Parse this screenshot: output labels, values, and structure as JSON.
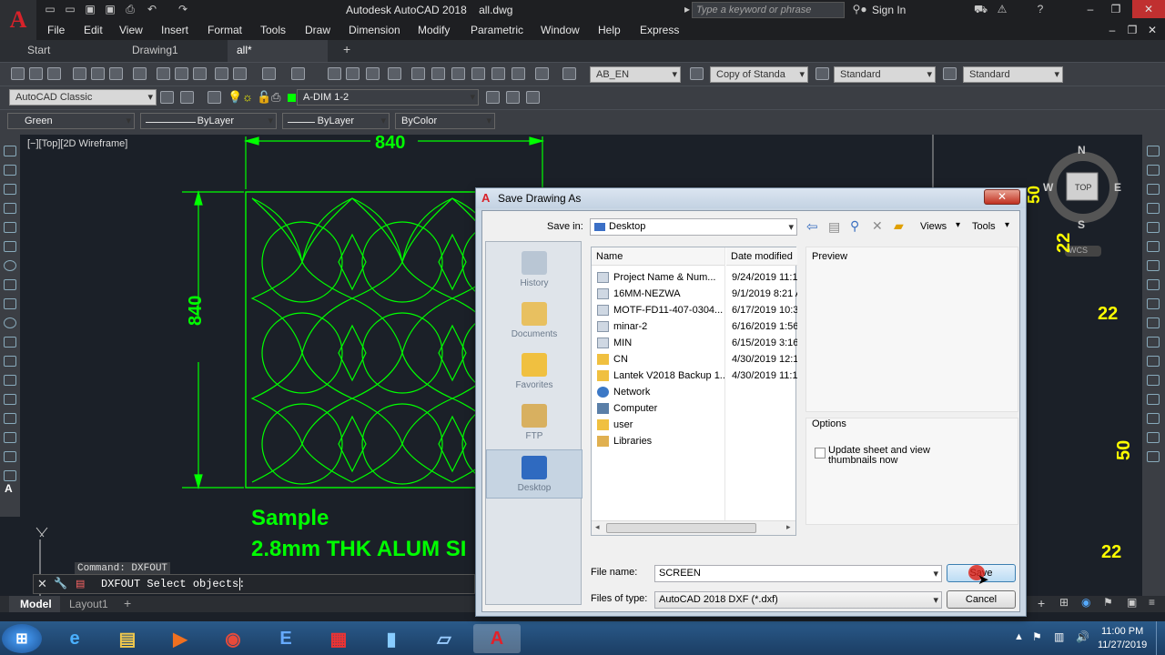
{
  "app": {
    "title": "Autodesk AutoCAD 2018    all.dwg",
    "search_placeholder": "Type a keyword or phrase",
    "signin": "Sign In"
  },
  "menu": [
    "File",
    "Edit",
    "View",
    "Insert",
    "Format",
    "Tools",
    "Draw",
    "Dimension",
    "Modify",
    "Parametric",
    "Window",
    "Help",
    "Express"
  ],
  "tabs": [
    "Start",
    "Drawing1",
    "all*"
  ],
  "toolbar": {
    "text_style": "AB_EN",
    "dim_style": "Copy of Standa",
    "table_style": "Standard",
    "mleader_style": "Standard",
    "workspace": "AutoCAD Classic",
    "layer": "A-DIM 1-2",
    "color": "Green",
    "linetype": "ByLayer",
    "lineweight": "ByLayer",
    "plotstyle": "ByColor"
  },
  "viewport": {
    "label": "[−][Top][2D Wireframe]"
  },
  "drawing": {
    "dim_width": "840",
    "dim_height": "840",
    "title": "Sample",
    "subtitle": "2.8mm THK ALUM SI",
    "right_labels": [
      "22",
      "22",
      "50",
      "50",
      "22"
    ]
  },
  "viewcube": {
    "north": "N",
    "south": "S",
    "east": "E",
    "west": "W",
    "top": "TOP",
    "wcs": "WCS"
  },
  "command": {
    "history": "Command: DXFOUT",
    "prompt": "DXFOUT Select objects:"
  },
  "layout_tabs": [
    "Model",
    "Layout1"
  ],
  "dialog": {
    "title": "Save Drawing As",
    "save_in_label": "Save in:",
    "save_in_value": "Desktop",
    "views": "Views",
    "tools": "Tools",
    "places": [
      "History",
      "Documents",
      "Favorites",
      "FTP",
      "Desktop"
    ],
    "col_name": "Name",
    "col_date": "Date modified",
    "files": [
      {
        "name": "Project Name & Num...",
        "date": "9/24/2019 11:1"
      },
      {
        "name": "16MM-NEZWA",
        "date": "9/1/2019 8:21 A"
      },
      {
        "name": "MOTF-FD11-407-0304...",
        "date": "6/17/2019 10:3"
      },
      {
        "name": "minar-2",
        "date": "6/16/2019 1:56"
      },
      {
        "name": "MIN",
        "date": "6/15/2019 3:16"
      },
      {
        "name": "CN",
        "date": "4/30/2019 12:1"
      },
      {
        "name": "Lantek V2018 Backup 1...",
        "date": "4/30/2019 11:1"
      },
      {
        "name": "Network",
        "date": ""
      },
      {
        "name": "Computer",
        "date": ""
      },
      {
        "name": "user",
        "date": ""
      },
      {
        "name": "Libraries",
        "date": ""
      }
    ],
    "preview_label": "Preview",
    "options_label": "Options",
    "update_thumbs": "Update sheet and view thumbnails now",
    "file_name_label": "File name:",
    "file_name_value": "SCREEN",
    "file_type_label": "Files of type:",
    "file_type_value": "AutoCAD 2018 DXF (*.dxf)",
    "save_button": "Save",
    "cancel_button": "Cancel"
  },
  "taskbar": {
    "time": "11:00 PM",
    "date": "11/27/2019"
  }
}
